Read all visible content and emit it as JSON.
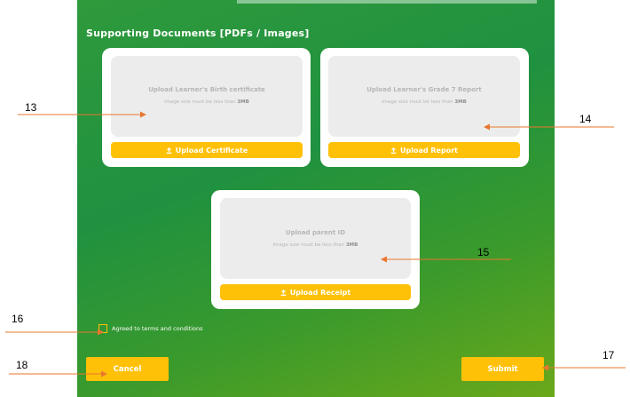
{
  "section_title": "Supporting Documents [PDFs / Images]",
  "cards": [
    {
      "dropzone_title": "Upload Learner's Birth certificate",
      "dropzone_sub_prefix": "image size must be less than",
      "dropzone_sub_size": "3MB",
      "button_label": "Upload Certificate"
    },
    {
      "dropzone_title": "Upload Learner's Grade 7 Report",
      "dropzone_sub_prefix": "image size must be less than",
      "dropzone_sub_size": "3MB",
      "button_label": "Upload Report"
    },
    {
      "dropzone_title": "Upload parent ID",
      "dropzone_sub_prefix": "image size must be less than",
      "dropzone_sub_size": "3MB",
      "button_label": "Upload Receipt"
    }
  ],
  "terms_label": "Agreed to terms and conditions",
  "cancel_label": "Cancel",
  "submit_label": "Submit",
  "annotations": [
    "13",
    "14",
    "15",
    "16",
    "17",
    "18"
  ],
  "colors": {
    "accent": "#ffc107",
    "panel_green": "#1f9140",
    "arrow": "#e8772e"
  },
  "icons": {
    "upload": "upload-icon",
    "checkbox": "checkbox-icon"
  }
}
